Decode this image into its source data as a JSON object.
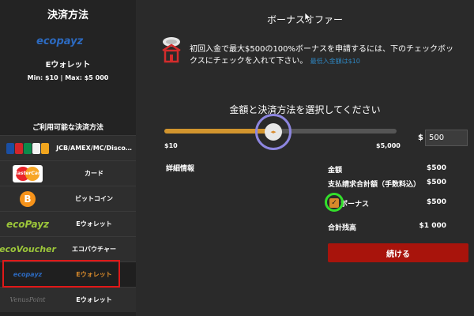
{
  "sidebar": {
    "title": "決済方法",
    "current_method": {
      "logo_text": "ecopayz",
      "name": "Eウォレット",
      "limits": "Min: $10 | Max: $5 000"
    },
    "available_title": "ご利用可能な決済方法",
    "methods": [
      {
        "logo": "card-brands-logo",
        "label": "JCB/AMEX/MC/Disco…"
      },
      {
        "logo": "mastercard-logo",
        "logo_text": "MasterCard",
        "label": "カード"
      },
      {
        "logo": "bitcoin-logo",
        "logo_text": "B",
        "label": "ビットコイン"
      },
      {
        "logo": "ecopayz-logo",
        "logo_text": "ecoPayz",
        "label": "Eウォレット"
      },
      {
        "logo": "ecovoucher-logo",
        "logo_text": "ecoVoucher",
        "label": "エコバウチャー"
      },
      {
        "logo": "ewallet-logo",
        "logo_text": "ecopayz",
        "label": "Eウォレット",
        "selected": true
      },
      {
        "logo": "venuspoint-logo",
        "logo_text": "VenusPoint",
        "label": "Eウォレット"
      }
    ]
  },
  "main": {
    "bonus_title": "ボーナスオファー",
    "promo_text": "初回入金で最大$500の100%ボーナスを申請するには、下のチェックボックスにチェックを入れて下さい。",
    "min_deposit": "最低入金額は$10",
    "select_title": "金額と決済方法を選択してください",
    "slider": {
      "min_label": "$10",
      "max_label": "$5,000",
      "value": 500,
      "min": 10,
      "max": 5000
    },
    "amount": {
      "currency": "$",
      "value": "500"
    },
    "details_label": "詳細情報",
    "summary": [
      {
        "label": "金額",
        "value": "$500"
      },
      {
        "label": "支払請求合計額（手数料込）",
        "value": "$500"
      },
      {
        "label": "ボーナス",
        "value": "$500"
      },
      {
        "label": "合計残高",
        "value": "$1 000"
      }
    ],
    "bonus_checked": true,
    "continue_label": "続ける"
  },
  "colors": {
    "accent": "#d88a2b",
    "button": "#a8140c",
    "link": "#2e86c1"
  }
}
